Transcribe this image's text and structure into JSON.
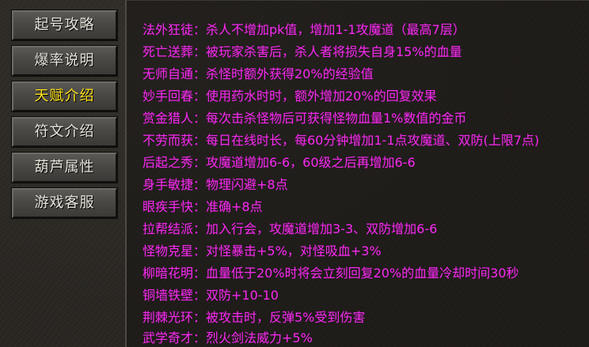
{
  "sidebar": {
    "items": [
      {
        "label": "起号攻略",
        "active": false
      },
      {
        "label": "爆率说明",
        "active": false
      },
      {
        "label": "天赋介绍",
        "active": true
      },
      {
        "label": "符文介绍",
        "active": false
      },
      {
        "label": "葫芦属性",
        "active": false
      },
      {
        "label": "游戏客服",
        "active": false
      }
    ]
  },
  "talents": [
    "法外狂徒：杀人不增加pk值，增加1-1攻魔道（最高7层）",
    "死亡送葬：被玩家杀害后，杀人者将损失自身15%的血量",
    "无师自通：杀怪时额外获得20%的经验值",
    "妙手回春：使用药水时时，额外增加20%的回复效果",
    "赏金猎人：每次击杀怪物后可获得怪物血量1%数值的金币",
    "不劳而获：每日在线时长，每60分钟增加1-1点攻魔道、双防(上限7点)",
    "后起之秀：攻魔道增加6-6，60级之后再增加6-6",
    "身手敏捷：物理闪避+8点",
    "眼疾手快：准确+8点",
    "拉帮结派：加入行会，攻魔道增加3-3、双防增加6-6",
    "怪物克星：对怪暴击+5%，对怪吸血+3%",
    "柳暗花明：血量低于20%时将会立刻回复20%的血量冷却时间30秒",
    "铜墙铁壁：双防+10-10",
    "荆棘光环：被攻击时，反弹5%受到伤害",
    "武学奇才：烈火剑法威力+5%"
  ],
  "colors": {
    "text_talent": "#f02de8",
    "text_nav": "#e9e6dd",
    "text_nav_active": "#ffe21a"
  }
}
